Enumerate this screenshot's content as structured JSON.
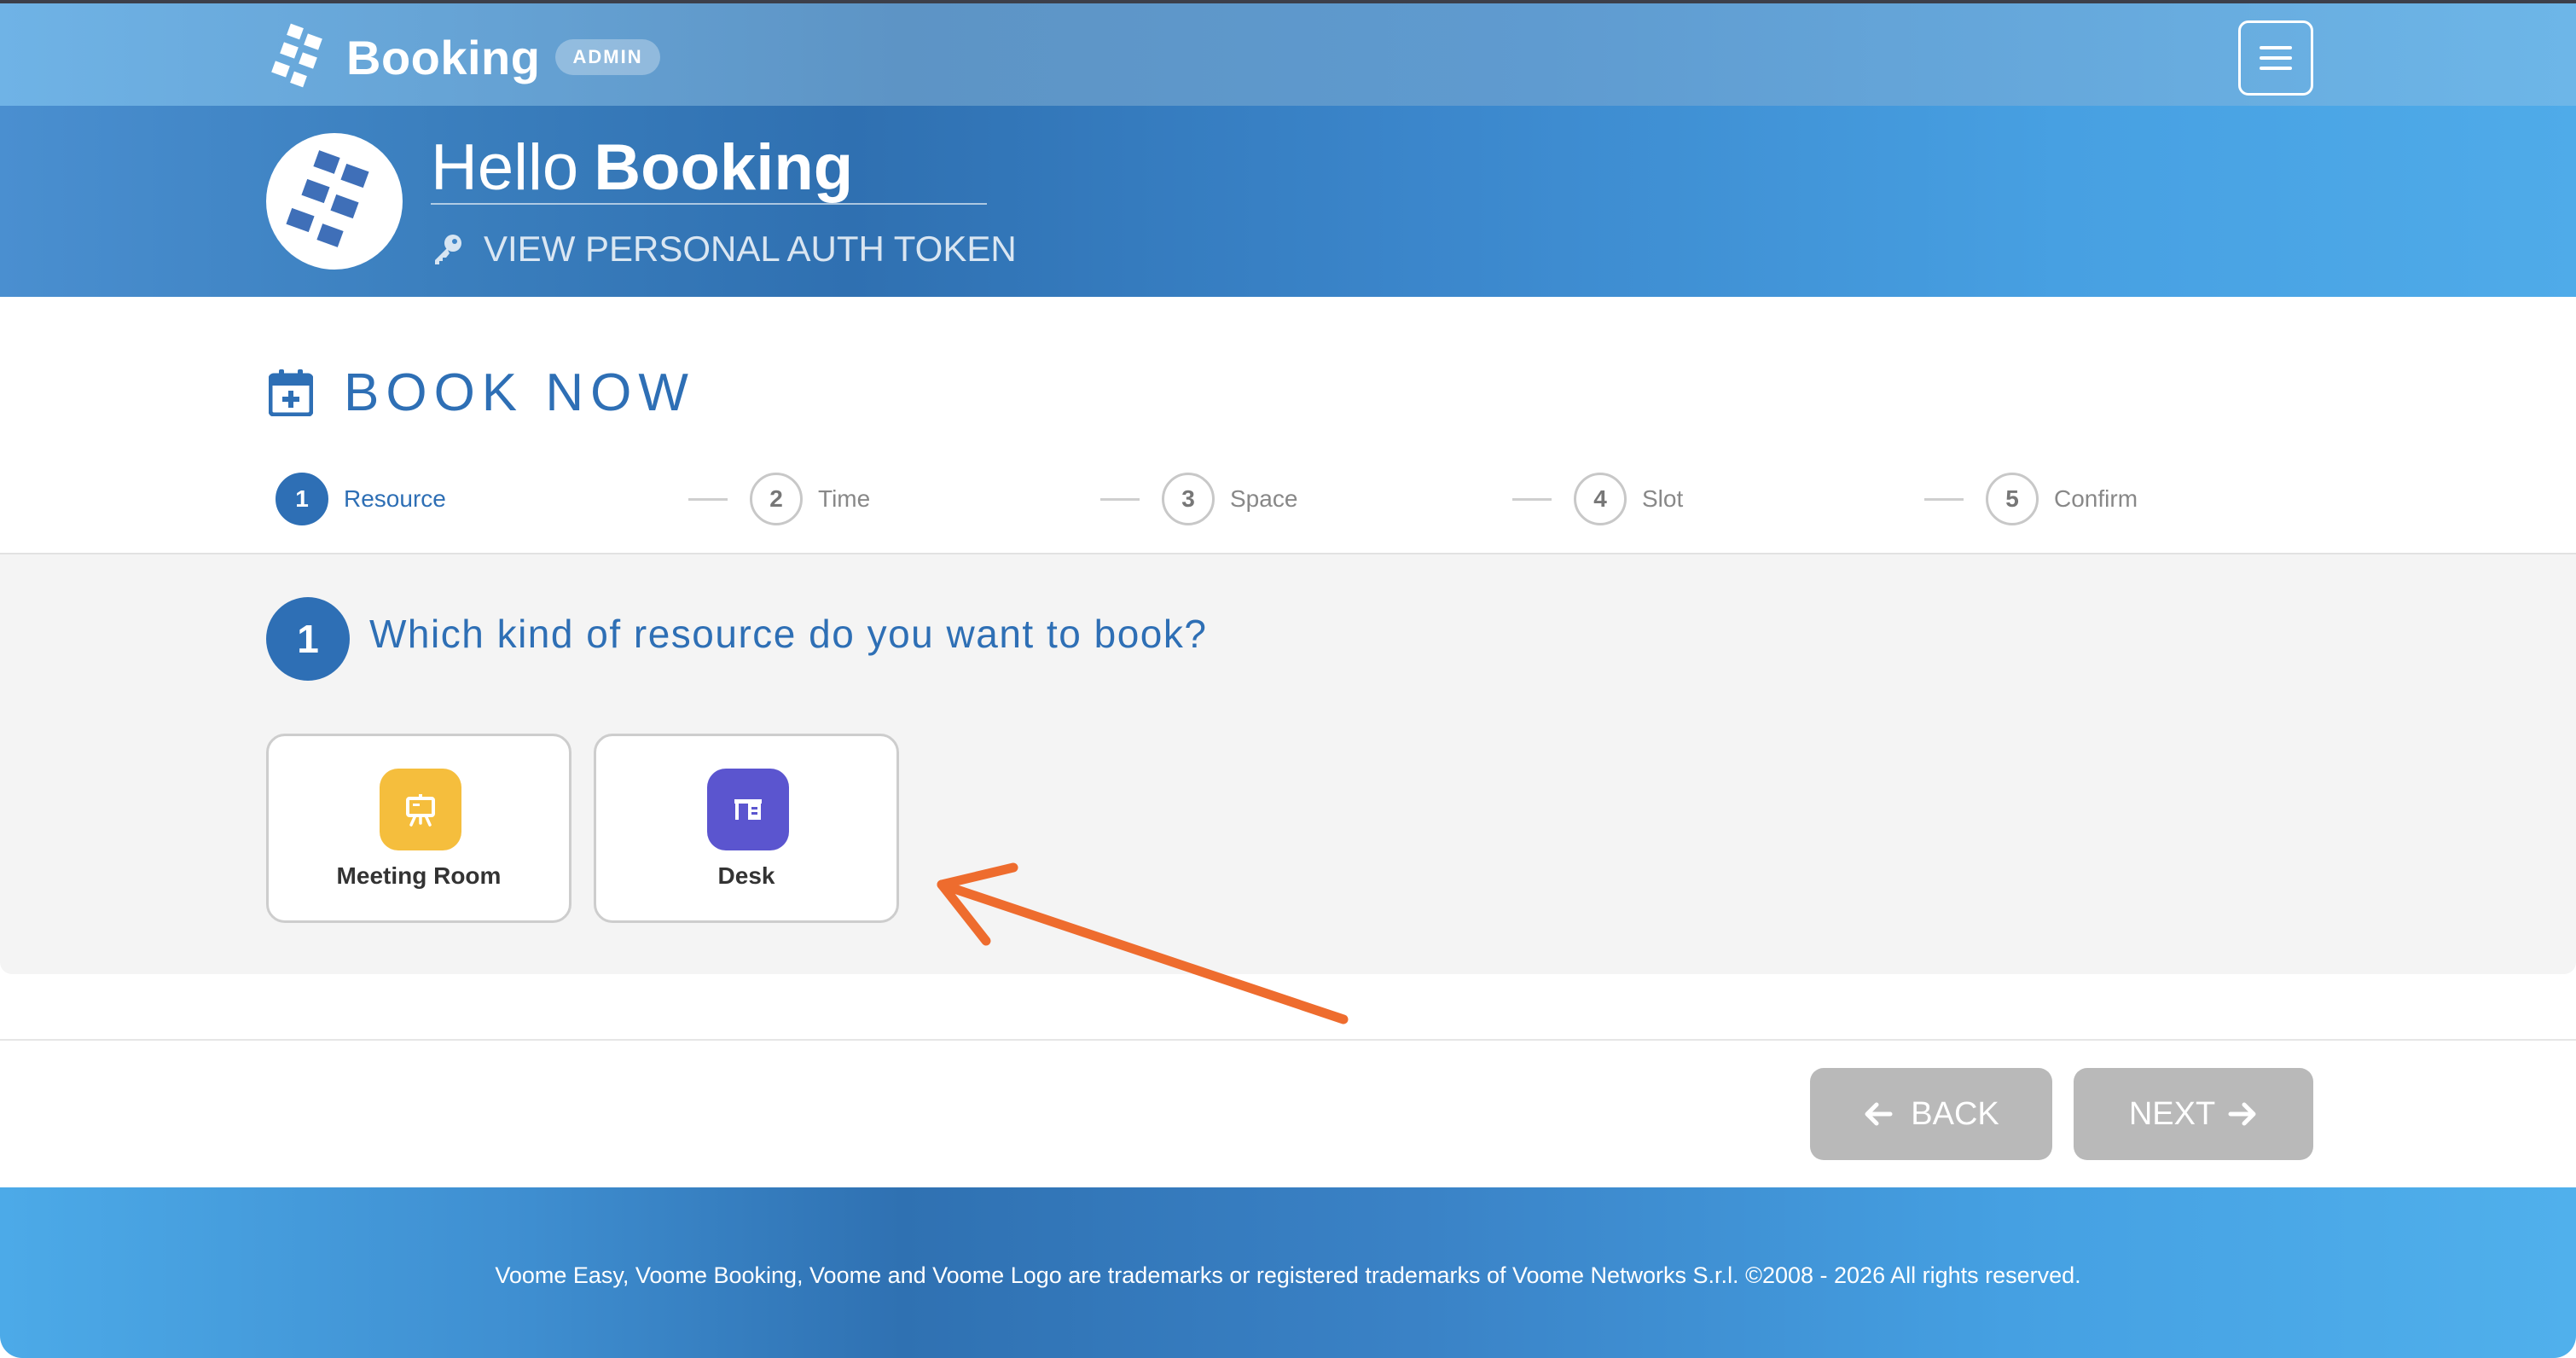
{
  "header": {
    "app_name": "Booking",
    "role_badge": "ADMIN",
    "menu_icon": "hamburger-menu-icon"
  },
  "hero": {
    "greeting_prefix": "Hello",
    "greeting_name": "Booking",
    "auth_token_label": "VIEW PERSONAL AUTH TOKEN",
    "auth_icon": "key-icon"
  },
  "page": {
    "title": "BOOK NOW",
    "title_icon": "calendar-plus-icon"
  },
  "stepper": {
    "steps": [
      {
        "number": "1",
        "label": "Resource",
        "active": true
      },
      {
        "number": "2",
        "label": "Time",
        "active": false
      },
      {
        "number": "3",
        "label": "Space",
        "active": false
      },
      {
        "number": "4",
        "label": "Slot",
        "active": false
      },
      {
        "number": "5",
        "label": "Confirm",
        "active": false
      }
    ]
  },
  "question": {
    "number": "1",
    "text": "Which kind of resource do you want to book?"
  },
  "resources": [
    {
      "name": "Meeting Room",
      "icon": "presentation-board-icon",
      "color": "#f5be3d"
    },
    {
      "name": "Desk",
      "icon": "desk-icon",
      "color": "#5b55cf"
    }
  ],
  "annotation": {
    "arrow_color": "#ee6c2e"
  },
  "navigation": {
    "back_label": "BACK",
    "next_label": "NEXT"
  },
  "footer": {
    "text": "Voome Easy, Voome Booking, Voome and Voome Logo are trademarks or registered trademarks of Voome Networks S.r.l. ©2008 - 2026 All rights reserved."
  },
  "colors": {
    "primary": "#2e6fb5",
    "disabled_button": "#b9b9b9"
  }
}
